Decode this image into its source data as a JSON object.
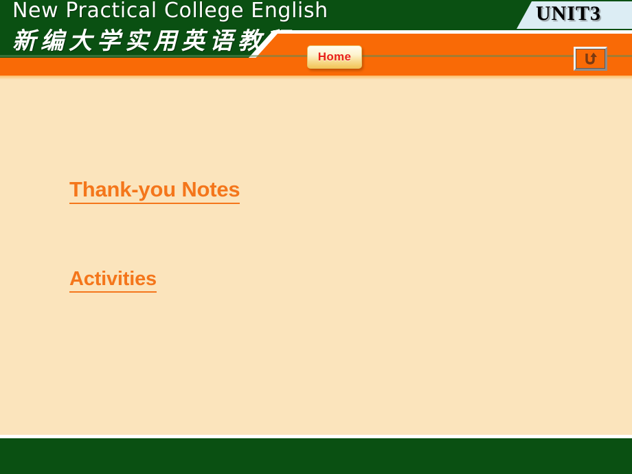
{
  "header": {
    "title_en": "New Practical College English",
    "title_cn": "新编大学实用英语教程",
    "unit_badge": "UNIT3",
    "home_label": "Home",
    "return_icon_name": "return-arrow-icon"
  },
  "content": {
    "links": [
      {
        "label": "Thank-you Notes"
      },
      {
        "label": "Activities"
      }
    ]
  },
  "colors": {
    "green": "#0a5012",
    "orange": "#f96a06",
    "body_cream": "#fbe4bc",
    "link_orange": "#f4761b",
    "home_text_red": "#e8211a",
    "unit_badge_bg": "#dcedf4"
  }
}
